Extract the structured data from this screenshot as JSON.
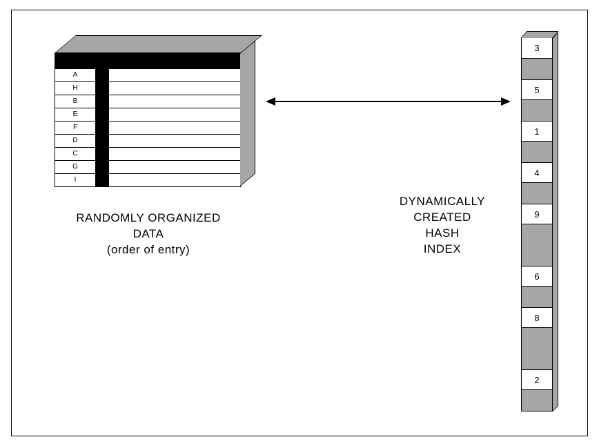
{
  "left": {
    "rows": [
      "A",
      "H",
      "B",
      "E",
      "F",
      "D",
      "C",
      "G",
      "I"
    ],
    "label_line1": "RANDOMLY ORGANIZED",
    "label_line2": "DATA",
    "label_line3": "(order of entry)"
  },
  "right": {
    "slots": [
      {
        "value": "3",
        "filled": true
      },
      {
        "value": "",
        "filled": false
      },
      {
        "value": "5",
        "filled": true
      },
      {
        "value": "",
        "filled": false
      },
      {
        "value": "1",
        "filled": true
      },
      {
        "value": "",
        "filled": false
      },
      {
        "value": "4",
        "filled": true
      },
      {
        "value": "",
        "filled": false
      },
      {
        "value": "9",
        "filled": true
      },
      {
        "value": "",
        "filled": false
      },
      {
        "value": "",
        "filled": false
      },
      {
        "value": "6",
        "filled": true
      },
      {
        "value": "",
        "filled": false
      },
      {
        "value": "8",
        "filled": true
      },
      {
        "value": "",
        "filled": false
      },
      {
        "value": "",
        "filled": false
      },
      {
        "value": "2",
        "filled": true
      },
      {
        "value": "",
        "filled": false
      }
    ],
    "label_line1": "DYNAMICALLY",
    "label_line2": "CREATED",
    "label_line3": "HASH",
    "label_line4": "INDEX"
  }
}
